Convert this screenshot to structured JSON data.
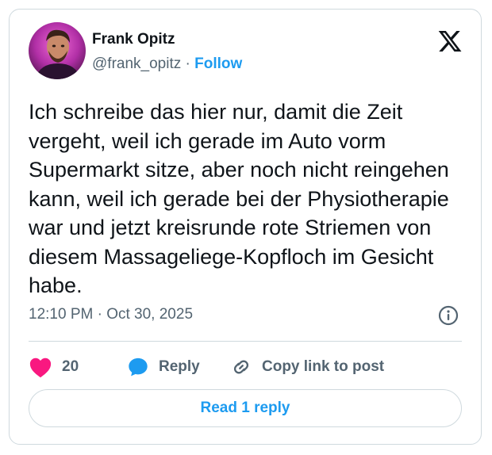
{
  "author": {
    "name": "Frank Opitz",
    "handle": "@frank_opitz",
    "separator": "·",
    "follow_label": "Follow"
  },
  "post": {
    "text": "Ich schreibe das hier nur, damit die Zeit vergeht, weil ich gerade im Auto vorm Supermarkt sitze, aber noch nicht reingehen kann, weil ich gerade bei der Physiotherapie war und jetzt kreisrunde rote Striemen von diesem Massageliege-Kopfloch im Gesicht habe.",
    "timestamp": "12:10 PM · Oct 30, 2025"
  },
  "actions": {
    "likes_count": "20",
    "reply_label": "Reply",
    "copy_link_label": "Copy link to post"
  },
  "read_replies_label": "Read 1 reply",
  "icons": {
    "logo": "x-logo-icon",
    "info": "info-icon",
    "like": "heart-icon",
    "reply": "speech-bubble-icon",
    "copy_link": "link-icon"
  },
  "colors": {
    "accent": "#1d9bf0",
    "like": "#f91880",
    "secondary_text": "#536471",
    "border": "#cfd9de"
  }
}
